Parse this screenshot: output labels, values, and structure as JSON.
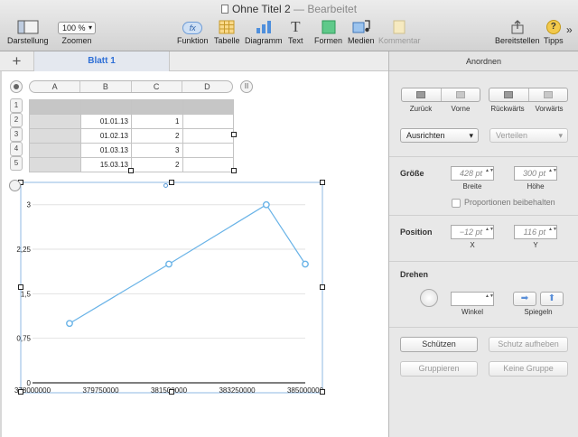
{
  "window": {
    "title": "Ohne Titel 2",
    "status": "— Bearbeitet"
  },
  "toolbar": {
    "darstellung": "Darstellung",
    "zoom_value": "100 %",
    "zoom_label": "Zoomen",
    "funktion": "Funktion",
    "funktion_icon_text": "fx",
    "tabelle": "Tabelle",
    "diagramm": "Diagramm",
    "text": "Text",
    "formen": "Formen",
    "medien": "Medien",
    "kommentar": "Kommentar",
    "bereitstellen": "Bereitstellen",
    "tipps": "Tipps",
    "overflow": "»"
  },
  "sheet": {
    "add_symbol": "+",
    "tab_label": "Blatt 1"
  },
  "table": {
    "columns": [
      "A",
      "B",
      "C",
      "D"
    ],
    "row_numbers": [
      "1",
      "2",
      "3",
      "4",
      "5"
    ],
    "rows": [
      [
        "",
        "",
        "",
        ""
      ],
      [
        "",
        "01.01.13",
        "1",
        ""
      ],
      [
        "",
        "01.02.13",
        "2",
        ""
      ],
      [
        "",
        "01.03.13",
        "3",
        ""
      ],
      [
        "",
        "15.03.13",
        "2",
        ""
      ]
    ],
    "pause_symbol": "II"
  },
  "chart_data": {
    "type": "line",
    "x": [
      378000000,
      381500000,
      383250000,
      385000000,
      379750000
    ],
    "points": [
      {
        "x": 378950000,
        "y": 1
      },
      {
        "x": 381500000,
        "y": 2
      },
      {
        "x": 384000000,
        "y": 3
      },
      {
        "x": 385000000,
        "y": 2
      }
    ],
    "x_ticks": [
      "378000000",
      "379750000",
      "381500000",
      "383250000",
      "385000000"
    ],
    "x_tick_values": [
      378000000,
      379750000,
      381500000,
      383250000,
      385000000
    ],
    "y_ticks": [
      "0",
      "0,75",
      "1,5",
      "2,25",
      "3"
    ],
    "y_tick_values": [
      0,
      0.75,
      1.5,
      2.25,
      3
    ],
    "xlim": [
      378000000,
      385000000
    ],
    "ylim": [
      0,
      3.3
    ],
    "grid": true,
    "color": "#69b3e7"
  },
  "inspector": {
    "title": "Anordnen",
    "zurueck": "Zurück",
    "vorne": "Vorne",
    "rueckwaerts": "Rückwärts",
    "vorwaerts": "Vorwärts",
    "ausrichten": "Ausrichten",
    "verteilen": "Verteilen",
    "groesse": "Größe",
    "breite_value": "428 pt",
    "breite_label": "Breite",
    "hoehe_value": "300 pt",
    "hoehe_label": "Höhe",
    "proportionen": "Proportionen beibehalten",
    "position": "Position",
    "x_value": "−12 pt",
    "x_label": "X",
    "y_value": "116 pt",
    "y_label": "Y",
    "drehen": "Drehen",
    "winkel_label": "Winkel",
    "spiegeln_label": "Spiegeln",
    "schuetzen": "Schützen",
    "schutz_aufheben": "Schutz aufheben",
    "gruppieren": "Gruppieren",
    "keine_gruppe": "Keine Gruppe",
    "stepper": "▲▼"
  }
}
